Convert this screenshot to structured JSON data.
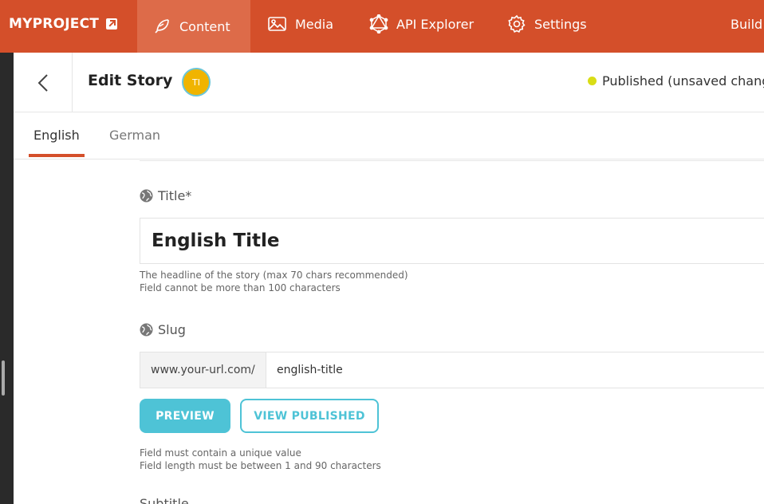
{
  "nav": {
    "brand": "MYPROJECT",
    "items": [
      {
        "label": "Content",
        "icon": "feather-icon"
      },
      {
        "label": "Media",
        "icon": "image-icon"
      },
      {
        "label": "API Explorer",
        "icon": "graphql-icon"
      },
      {
        "label": "Settings",
        "icon": "gear-icon"
      },
      {
        "label": "Build",
        "icon": ""
      }
    ],
    "active": "Content"
  },
  "header": {
    "title": "Edit Story",
    "avatar_initials": "TI",
    "status": "Published (unsaved chang"
  },
  "tabs": {
    "items": [
      {
        "label": "English"
      },
      {
        "label": "German"
      }
    ],
    "active": "English"
  },
  "form": {
    "title": {
      "label": "Title*",
      "value": "English Title",
      "help1": "The headline of the story (max 70 chars recommended)",
      "help2": "Field cannot be more than 100 characters"
    },
    "slug": {
      "label": "Slug",
      "prefix": "www.your-url.com/",
      "value": "english-title",
      "preview_label": "PREVIEW",
      "view_published_label": "VIEW PUBLISHED",
      "help1": "Field must contain a unique value",
      "help2": "Field length must be between 1 and 90 characters"
    },
    "next_label": "Subtitle"
  },
  "colors": {
    "brand": "#d44f2a",
    "accent": "#4ec3d6",
    "status_dot": "#d9dd16",
    "avatar": "#f0b400"
  }
}
